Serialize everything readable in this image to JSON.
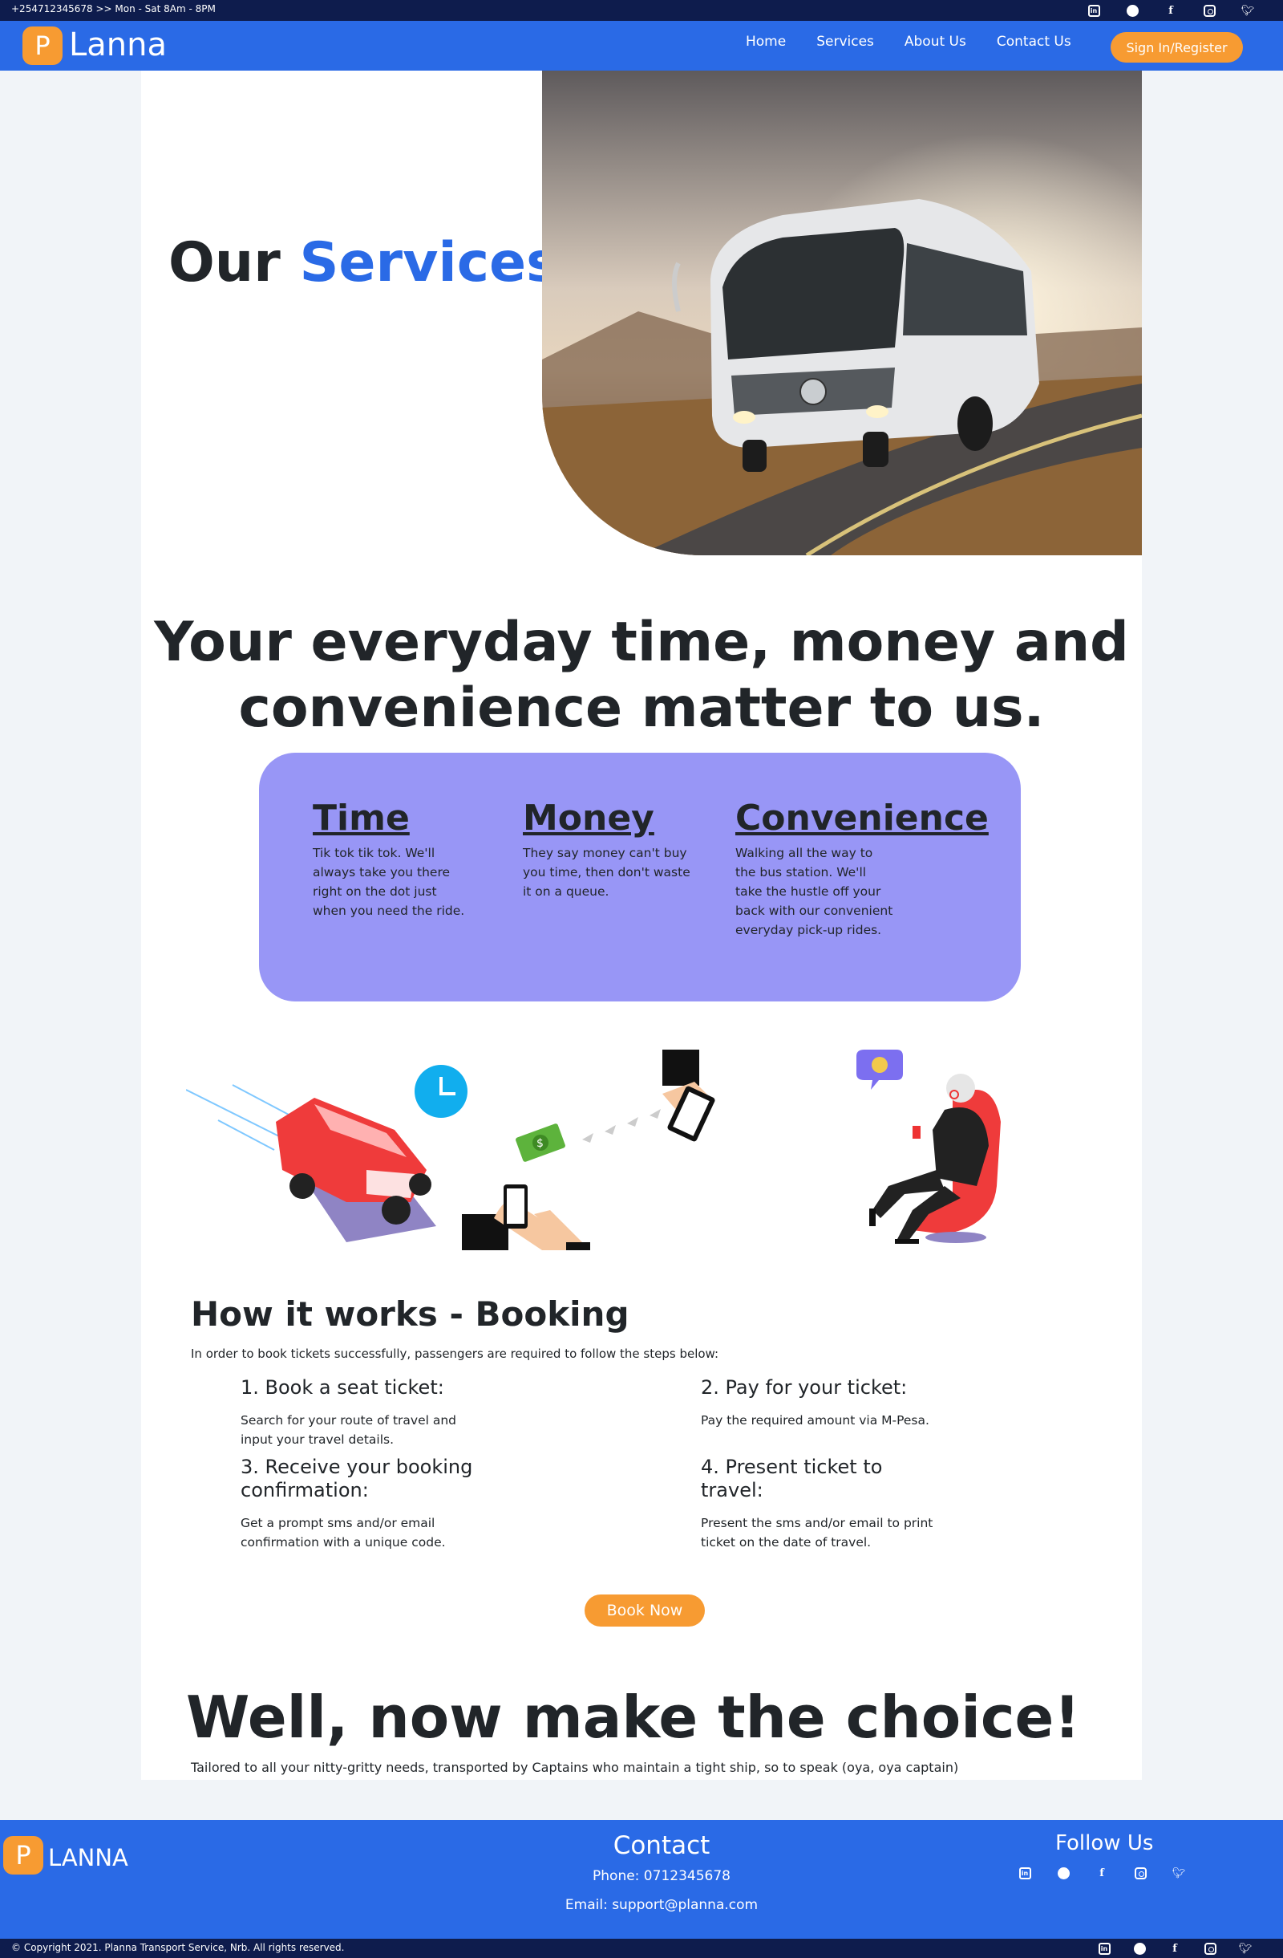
{
  "topbar": {
    "info": "+254712345678 >> Mon - Sat 8Am - 8PM",
    "social": [
      "linkedin-icon",
      "whatsapp-icon",
      "facebook-icon",
      "instagram-icon",
      "twitter-icon"
    ]
  },
  "nav": {
    "logo_letter": "P",
    "brand": "Lanna",
    "links": [
      "Home",
      "Services",
      "About Us",
      "Contact Us"
    ],
    "signin": "Sign In/Register"
  },
  "hero": {
    "title_1": "Our",
    "title_2": "Services"
  },
  "headline": "Your everyday time, money and convenience matter to us.",
  "values": [
    {
      "title": "Time",
      "text": "Tik tok tik tok. We'll always take you there right on the dot just when you need the ride."
    },
    {
      "title": "Money",
      "text": "They say money can't buy you time, then don't waste it on a queue."
    },
    {
      "title": "Convenience",
      "text": "Walking all the way to the bus station. We'll take the hustle off your back with our convenient everyday pick-up rides."
    }
  ],
  "how": {
    "title": "How it works - Booking",
    "intro": "In order to book tickets successfully, passengers are required to follow the steps below:",
    "steps": [
      {
        "title": "1. Book a seat ticket:",
        "text": "Search for your route of travel and input your travel details."
      },
      {
        "title": "2. Pay for your ticket:",
        "text": "Pay the required amount via M-Pesa."
      },
      {
        "title": "3. Receive your booking confirmation:",
        "text": "Get a prompt sms and/or email confirmation with a unique code."
      },
      {
        "title": "4. Present ticket to travel:",
        "text": "Present the sms and/or email to print ticket on the date of travel."
      }
    ],
    "cta": "Book Now"
  },
  "choice": {
    "title": "Well, now make the choice!",
    "subtitle": "Tailored to all your nitty-gritty needs, transported by Captains who maintain a tight ship, so to speak (oya, oya captain)"
  },
  "footer": {
    "logo_letter": "P",
    "brand": "LANNA",
    "contact_title": "Contact",
    "phone": "Phone: 0712345678",
    "email": "Email: support@planna.com",
    "follow": "Follow Us",
    "copyright": "© Copyright 2021. Planna Transport Service, Nrb. All rights reserved."
  },
  "colors": {
    "primary": "#2a6ae6",
    "accent": "#f79b32",
    "dark": "#0e1c4d",
    "card": "#9896f6"
  }
}
